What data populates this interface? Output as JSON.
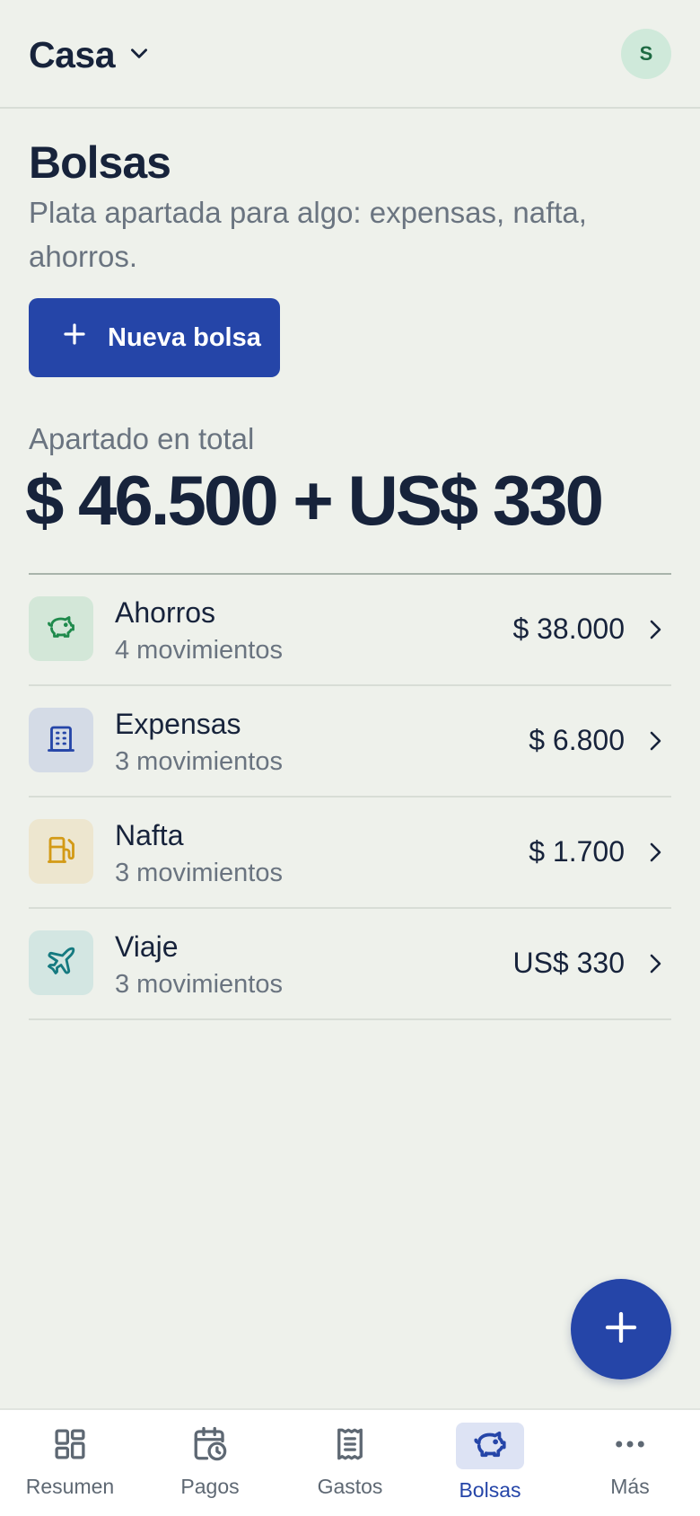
{
  "header": {
    "workspace": "Casa",
    "avatar_initial": "S"
  },
  "page": {
    "title": "Bolsas",
    "subtitle": "Plata apartada para algo: expensas, nafta, ahorros.",
    "new_button": "Nueva bolsa",
    "total_label": "Apartado en total",
    "total_value": "$ 46.500 + US$ 330"
  },
  "bags": [
    {
      "name": "Ahorros",
      "count": "4 movimientos",
      "amount": "$ 38.000",
      "icon": "piggy-bank-icon",
      "color": "#1f8a4c",
      "bg": "#d3e7d8"
    },
    {
      "name": "Expensas",
      "count": "3 movimientos",
      "amount": "$ 6.800",
      "icon": "building-icon",
      "color": "#2545a8",
      "bg": "#d4dbe6"
    },
    {
      "name": "Nafta",
      "count": "3 movimientos",
      "amount": "$ 1.700",
      "icon": "fuel-icon",
      "color": "#d39a16",
      "bg": "#ede6cf"
    },
    {
      "name": "Viaje",
      "count": "3 movimientos",
      "amount": "US$ 330",
      "icon": "plane-icon",
      "color": "#157a80",
      "bg": "#d3e6e2"
    }
  ],
  "nav": [
    {
      "label": "Resumen",
      "icon": "dashboard-icon",
      "active": false
    },
    {
      "label": "Pagos",
      "icon": "calendar-clock-icon",
      "active": false
    },
    {
      "label": "Gastos",
      "icon": "receipt-icon",
      "active": false
    },
    {
      "label": "Bolsas",
      "icon": "piggy-bank-icon",
      "active": true
    },
    {
      "label": "Más",
      "icon": "more-icon",
      "active": false
    }
  ],
  "colors": {
    "accent": "#2545a8",
    "background": "#eef1eb",
    "text": "#17233b",
    "muted": "#6a7480"
  }
}
